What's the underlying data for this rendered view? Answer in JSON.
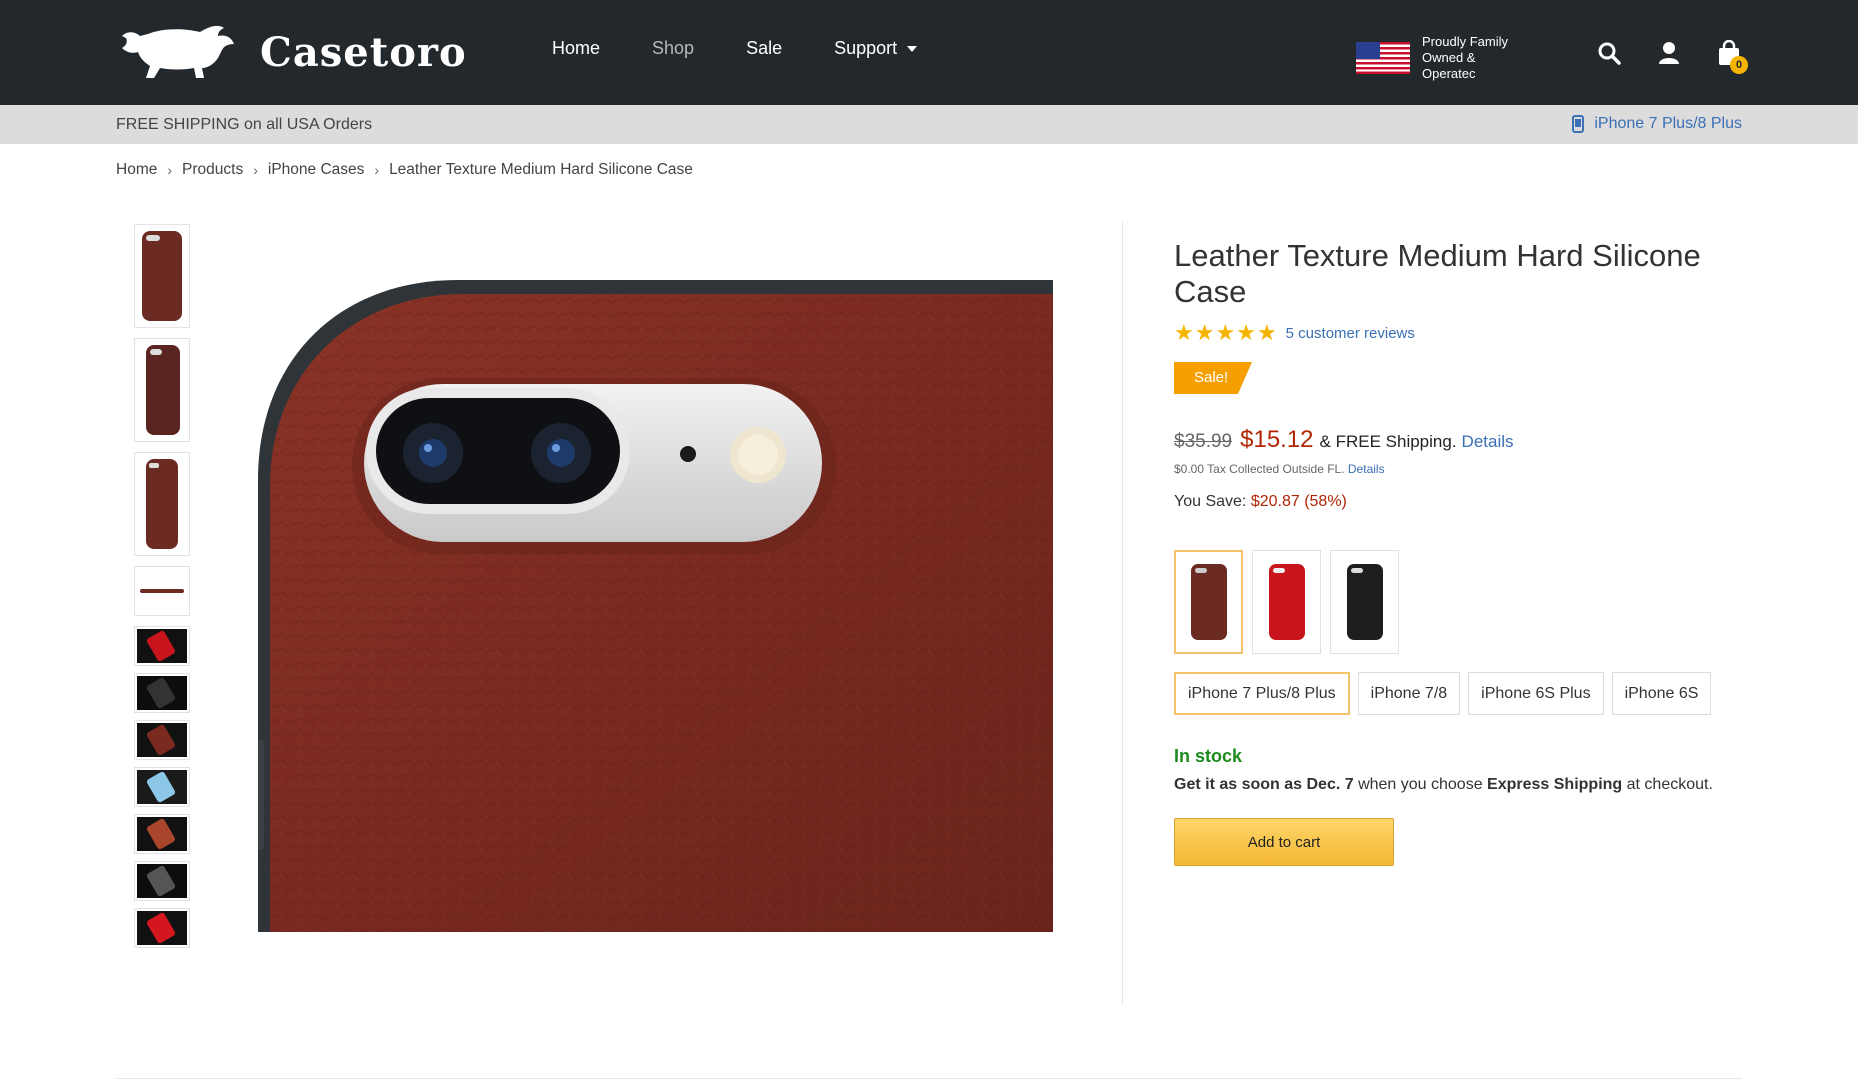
{
  "brand": {
    "name": "Casetoro",
    "logo_icon": "bull-icon"
  },
  "nav": {
    "items": [
      {
        "label": "Home"
      },
      {
        "label": "Shop"
      },
      {
        "label": "Sale"
      },
      {
        "label": "Support"
      }
    ]
  },
  "header": {
    "tagline": "Proudly Family Owned & Operatec",
    "flag_icon": "us-flag-icon",
    "cart_count": "0"
  },
  "shipbar": {
    "free_shipping": "FREE SHIPPING on all USA Orders",
    "device": "iPhone 7 Plus/8 Plus"
  },
  "breadcrumb": {
    "items": [
      "Home",
      "Products",
      "iPhone Cases",
      "Leather Texture Medium Hard Silicone Case"
    ],
    "separator": "›"
  },
  "product": {
    "title": "Leather Texture Medium Hard Silicone Case",
    "rating": 5,
    "reviews": "5 customer reviews",
    "sale_badge": "Sale!",
    "old_price": "$35.99",
    "new_price": "$15.12",
    "shipping": "& FREE Shipping.",
    "details": "Details",
    "tax": "$0.00 Tax Collected Outside FL.",
    "tax_details": "Details",
    "save_label": "You Save:",
    "save_amount": "$20.87 (58%)",
    "colors": [
      {
        "name": "brown",
        "hex": "#6b2a22",
        "selected": true
      },
      {
        "name": "red",
        "hex": "#c8141c",
        "selected": false
      },
      {
        "name": "black",
        "hex": "#1e1e1e",
        "selected": false
      }
    ],
    "models": [
      {
        "label": "iPhone 7 Plus/8 Plus",
        "selected": true
      },
      {
        "label": "iPhone 7/8",
        "selected": false
      },
      {
        "label": "iPhone 6S Plus",
        "selected": false
      },
      {
        "label": "iPhone 6S",
        "selected": false
      }
    ],
    "stock": "In stock",
    "eta_prefix": "Get it as soon as Dec. 7",
    "eta_mid": " when you choose ",
    "eta_bold": "Express Shipping",
    "eta_suffix": " at checkout.",
    "add_to_cart": "Add to cart"
  },
  "colors": {
    "header_bg": "#23282d",
    "accent": "#f5b400",
    "link": "#3b6fb6",
    "price": "#b12704",
    "stock": "#1e8a1e"
  }
}
